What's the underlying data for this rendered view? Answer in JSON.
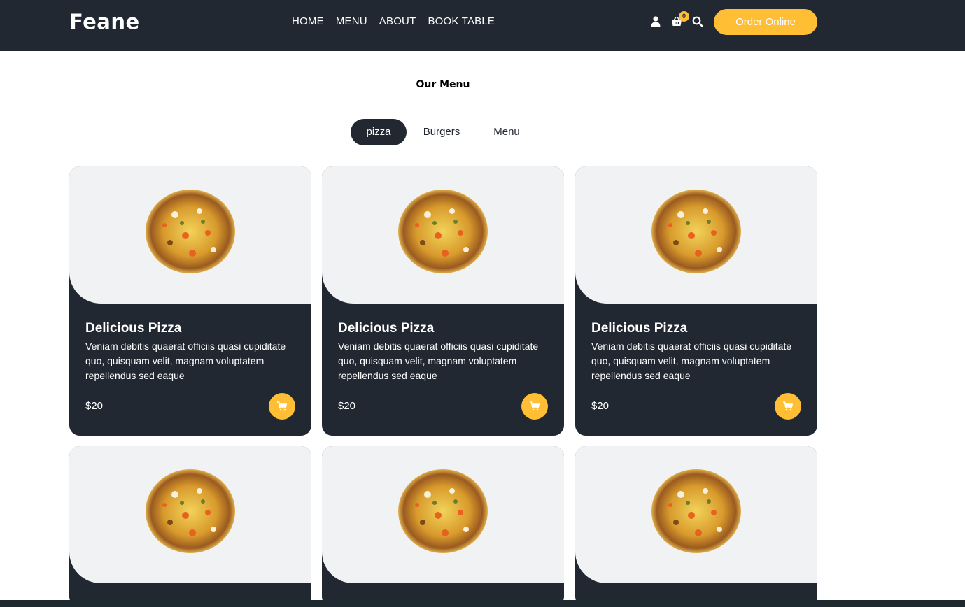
{
  "header": {
    "logo": "Feane",
    "nav": [
      "HOME",
      "MENU",
      "ABOUT",
      "BOOK TABLE"
    ],
    "cart_count": "0",
    "order_button": "Order Online",
    "icons": [
      "user-icon",
      "cart-icon",
      "search-icon"
    ]
  },
  "section": {
    "title": "Our Menu",
    "filters": [
      "pizza",
      "Burgers",
      "Menu"
    ],
    "active_filter": "pizza"
  },
  "cards": [
    {
      "title": "Delicious Pizza",
      "description": "Veniam debitis quaerat officiis quasi cupiditate quo, quisquam velit, magnam voluptatem repellendus sed eaque",
      "price": "$20"
    },
    {
      "title": "Delicious Pizza",
      "description": "Veniam debitis quaerat officiis quasi cupiditate quo, quisquam velit, magnam voluptatem repellendus sed eaque",
      "price": "$20"
    },
    {
      "title": "Delicious Pizza",
      "description": "Veniam debitis quaerat officiis quasi cupiditate quo, quisquam velit, magnam voluptatem repellendus sed eaque",
      "price": "$20"
    },
    {
      "title": "",
      "description": "",
      "price": ""
    },
    {
      "title": "",
      "description": "",
      "price": ""
    },
    {
      "title": "",
      "description": "",
      "price": ""
    }
  ],
  "colors": {
    "dark": "#222831",
    "accent": "#ffbe33",
    "light": "#f1f2f3"
  }
}
